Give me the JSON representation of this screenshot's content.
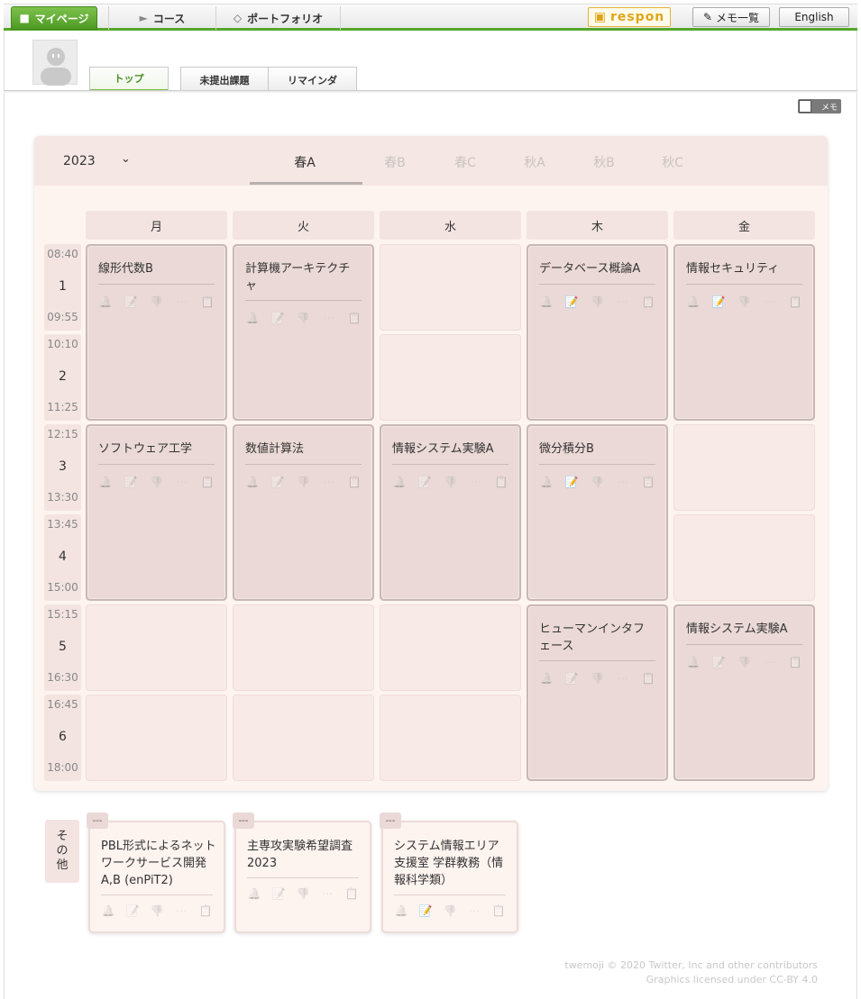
{
  "nav": {
    "tabs": [
      {
        "label": "マイページ",
        "icon": "person-icon"
      },
      {
        "label": "コース",
        "icon": "teacher-icon"
      },
      {
        "label": "ポートフォリオ",
        "icon": "layers-icon"
      }
    ],
    "respon_label": "respon",
    "memo_list_label": "メモ一覧",
    "language_label": "English"
  },
  "subnav": {
    "tabs": [
      "トップ",
      "未提出課題",
      "リマインダ"
    ],
    "memo_label": "メモ"
  },
  "timetable": {
    "year": "2023",
    "terms": [
      "春A",
      "春B",
      "春C",
      "秋A",
      "秋B",
      "秋C"
    ],
    "active_term": "春A",
    "days": [
      "月",
      "火",
      "水",
      "木",
      "金"
    ],
    "periods": [
      {
        "num": "1",
        "start": "08:40",
        "end": "09:55"
      },
      {
        "num": "2",
        "start": "10:10",
        "end": "11:25"
      },
      {
        "num": "3",
        "start": "12:15",
        "end": "13:30"
      },
      {
        "num": "4",
        "start": "13:45",
        "end": "15:00"
      },
      {
        "num": "5",
        "start": "15:15",
        "end": "16:30"
      },
      {
        "num": "6",
        "start": "16:45",
        "end": "18:00"
      }
    ],
    "courses": [
      {
        "title": "線形代数B",
        "day": 0,
        "period": 1,
        "span": 2,
        "memo_on": false
      },
      {
        "title": "計算機アーキテクチャ",
        "day": 1,
        "period": 1,
        "span": 2,
        "memo_on": false
      },
      {
        "title": "データベース概論A",
        "day": 3,
        "period": 1,
        "span": 2,
        "memo_on": true
      },
      {
        "title": "情報セキュリティ",
        "day": 4,
        "period": 1,
        "span": 2,
        "memo_on": true
      },
      {
        "title": "ソフトウェア工学",
        "day": 0,
        "period": 3,
        "span": 2,
        "memo_on": false
      },
      {
        "title": "数値計算法",
        "day": 1,
        "period": 3,
        "span": 2,
        "memo_on": false
      },
      {
        "title": "情報システム実験A",
        "day": 2,
        "period": 3,
        "span": 2,
        "memo_on": false
      },
      {
        "title": "微分積分B",
        "day": 3,
        "period": 3,
        "span": 2,
        "memo_on": true
      },
      {
        "title": "ヒューマンインタフェース",
        "day": 3,
        "period": 5,
        "span": 2,
        "memo_on": false
      },
      {
        "title": "情報システム実験A",
        "day": 4,
        "period": 5,
        "span": 2,
        "memo_on": false
      }
    ]
  },
  "others": {
    "label": "その他",
    "items": [
      {
        "tag": "---",
        "title": "PBL形式によるネットワークサービス開発A,B (enPiT2)",
        "memo_on": false
      },
      {
        "tag": "---",
        "title": "主専攻実験希望調査2023",
        "memo_on": false
      },
      {
        "tag": "---",
        "title": "システム情報エリア支援室 学群教務（情報科学類）",
        "memo_on": true
      }
    ]
  },
  "footer": {
    "credit_line1": "twemoji © 2020 Twitter, Inc and other contributors",
    "credit_line2": "Graphics licensed under CC-BY 4.0"
  },
  "icon_glyphs": {
    "bell": "🔔",
    "memo": "📝",
    "thumbs": "👎",
    "more": "⋯",
    "clip": "📋"
  }
}
